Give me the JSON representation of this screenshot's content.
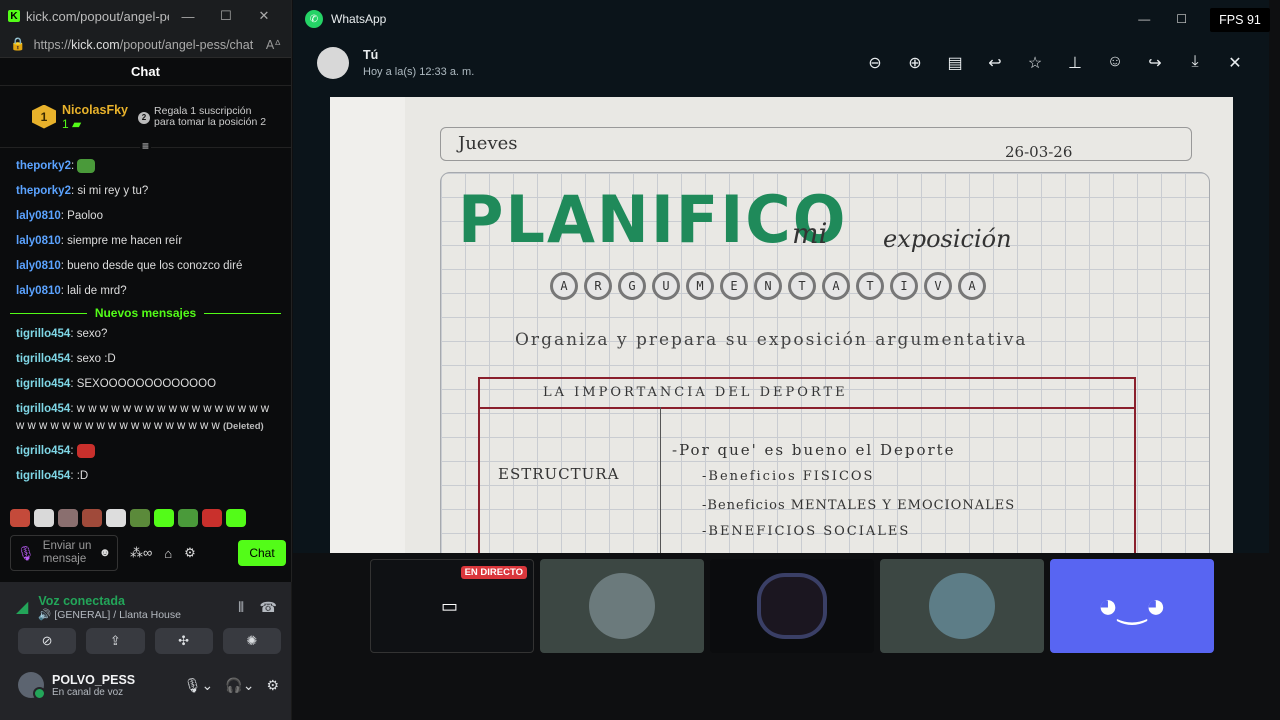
{
  "kick": {
    "window_title": "kick.com/popout/angel-pes...",
    "url_prefix": "https://",
    "url_host": "kick.com",
    "url_path": "/popout/angel-pess/chat",
    "chat_title": "Chat",
    "top_user": {
      "rank": "1",
      "name": "NicolasFky",
      "count": "1"
    },
    "sub_offer": {
      "rank": "2",
      "text": "Regala 1 suscripción para tomar la posición 2"
    },
    "messages_before": [
      {
        "user": "theporky2",
        "text": "",
        "emote": true,
        "color": "blue"
      },
      {
        "user": "theporky2",
        "text": "si mi rey y tu?",
        "color": "blue"
      },
      {
        "user": "laly0810",
        "text": "Paoloo",
        "color": "blue"
      },
      {
        "user": "laly0810",
        "text": "siempre me hacen reír",
        "color": "blue"
      },
      {
        "user": "laly0810",
        "text": "bueno desde que los conozco diré",
        "color": "blue"
      },
      {
        "user": "laly0810",
        "text": "lali de mrd?",
        "color": "blue"
      }
    ],
    "new_messages_label": "Nuevos mensajes",
    "messages_after": [
      {
        "user": "tigrillo454",
        "text": "sexo?"
      },
      {
        "user": "tigrillo454",
        "text": "sexo :D"
      },
      {
        "user": "tigrillo454",
        "text": "SEXOOOOOOOOOOOOO"
      },
      {
        "user": "tigrillo454",
        "text": "w w w w w w w w w w w w w w w w w w w w w w w w w w w w w w w w w w w",
        "deleted": "(Deleted)"
      },
      {
        "user": "tigrillo454",
        "text": "",
        "emote": true
      },
      {
        "user": "tigrillo454",
        "text": ":D"
      }
    ],
    "input_placeholder": "Enviar un mensaje",
    "send_label": "Chat"
  },
  "discord": {
    "voice_status": "Voz conectada",
    "voice_channel": "[GENERAL] / Llanta House",
    "username": "POLVO_PESS",
    "user_status": "En canal de voz",
    "live_badge": "EN DIRECTO"
  },
  "whatsapp": {
    "app_title": "WhatsApp",
    "sender": "Tú",
    "timestamp": "Hoy a la(s) 12:33 a. m.",
    "photo": {
      "day": "Jueves",
      "date": "26-03-26",
      "title": "PLANIFICO",
      "mi": "mi",
      "exposicion": "exposición",
      "letters": [
        "A",
        "R",
        "G",
        "U",
        "M",
        "E",
        "N",
        "T",
        "A",
        "T",
        "I",
        "V",
        "A"
      ],
      "instruction": "Organiza y prepara su exposición argumentativa",
      "table_header": "LA IMPORTANCIA DEL DEPORTE",
      "row_label": "ESTRUCTURA",
      "bullets": [
        "-Por que' es bueno el Deporte",
        "-Beneficios FISICOS",
        "-Beneficios MENTALES Y EMOCIONALES",
        "-BENEFICIOS SOCIALES"
      ]
    }
  },
  "overlay": {
    "fps": "FPS 91"
  }
}
